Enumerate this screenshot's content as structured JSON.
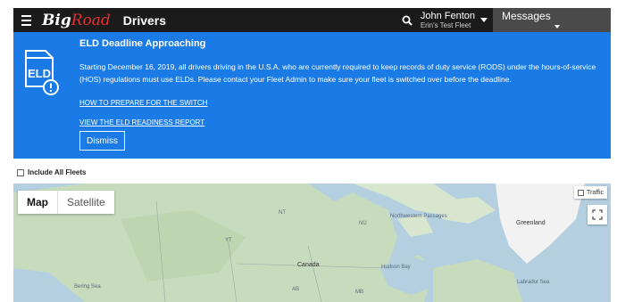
{
  "topbar": {
    "logo_big": "Big",
    "logo_road": "Road",
    "title": "Drivers",
    "user_name": "John Fenton",
    "user_fleet": "Erin's Test Fleet",
    "messages_label": "Messages",
    "icons": [
      "menu-icon",
      "search-icon",
      "chevron-down-icon"
    ]
  },
  "banner": {
    "icon_text": "ELD",
    "title": "ELD Deadline Approaching",
    "body": "Starting December 16, 2019, all drivers driving in the U.S.A. who are currently required to keep records of duty service (RODS) under the hours-of-service (HOS) regulations must use ELDs. Please contact your Fleet Admin to make sure your fleet is switched over before the deadline.",
    "link_prepare": "HOW TO PREPARE FOR THE SWITCH",
    "link_report": "VIEW THE ELD READINESS REPORT",
    "dismiss_label": "Dismiss",
    "color": "#1a7be6"
  },
  "filters": {
    "include_all_fleets_label": "Include All Fleets",
    "include_all_fleets_checked": false
  },
  "map": {
    "tab_map": "Map",
    "tab_satellite": "Satellite",
    "selected_tab": "Map",
    "traffic_label": "Traffic",
    "traffic_checked": false,
    "labels": {
      "nu": "NU",
      "northwestern": "Northwestern Passages",
      "greenland": "Greenland",
      "nt": "NT",
      "yt": "YT",
      "canada": "Canada",
      "hudson": "Hudson Bay",
      "bering": "Bering Sea",
      "labrador": "Labrador Sea",
      "ab": "AB",
      "mb": "MB"
    }
  }
}
